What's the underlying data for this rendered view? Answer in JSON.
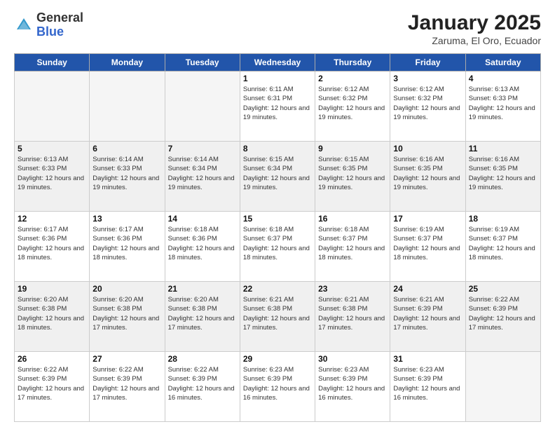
{
  "logo": {
    "general": "General",
    "blue": "Blue"
  },
  "title": "January 2025",
  "subtitle": "Zaruma, El Oro, Ecuador",
  "days_of_week": [
    "Sunday",
    "Monday",
    "Tuesday",
    "Wednesday",
    "Thursday",
    "Friday",
    "Saturday"
  ],
  "weeks": [
    [
      {
        "day": "",
        "info": ""
      },
      {
        "day": "",
        "info": ""
      },
      {
        "day": "",
        "info": ""
      },
      {
        "day": "1",
        "info": "Sunrise: 6:11 AM\nSunset: 6:31 PM\nDaylight: 12 hours and 19 minutes."
      },
      {
        "day": "2",
        "info": "Sunrise: 6:12 AM\nSunset: 6:32 PM\nDaylight: 12 hours and 19 minutes."
      },
      {
        "day": "3",
        "info": "Sunrise: 6:12 AM\nSunset: 6:32 PM\nDaylight: 12 hours and 19 minutes."
      },
      {
        "day": "4",
        "info": "Sunrise: 6:13 AM\nSunset: 6:33 PM\nDaylight: 12 hours and 19 minutes."
      }
    ],
    [
      {
        "day": "5",
        "info": "Sunrise: 6:13 AM\nSunset: 6:33 PM\nDaylight: 12 hours and 19 minutes."
      },
      {
        "day": "6",
        "info": "Sunrise: 6:14 AM\nSunset: 6:33 PM\nDaylight: 12 hours and 19 minutes."
      },
      {
        "day": "7",
        "info": "Sunrise: 6:14 AM\nSunset: 6:34 PM\nDaylight: 12 hours and 19 minutes."
      },
      {
        "day": "8",
        "info": "Sunrise: 6:15 AM\nSunset: 6:34 PM\nDaylight: 12 hours and 19 minutes."
      },
      {
        "day": "9",
        "info": "Sunrise: 6:15 AM\nSunset: 6:35 PM\nDaylight: 12 hours and 19 minutes."
      },
      {
        "day": "10",
        "info": "Sunrise: 6:16 AM\nSunset: 6:35 PM\nDaylight: 12 hours and 19 minutes."
      },
      {
        "day": "11",
        "info": "Sunrise: 6:16 AM\nSunset: 6:35 PM\nDaylight: 12 hours and 19 minutes."
      }
    ],
    [
      {
        "day": "12",
        "info": "Sunrise: 6:17 AM\nSunset: 6:36 PM\nDaylight: 12 hours and 18 minutes."
      },
      {
        "day": "13",
        "info": "Sunrise: 6:17 AM\nSunset: 6:36 PM\nDaylight: 12 hours and 18 minutes."
      },
      {
        "day": "14",
        "info": "Sunrise: 6:18 AM\nSunset: 6:36 PM\nDaylight: 12 hours and 18 minutes."
      },
      {
        "day": "15",
        "info": "Sunrise: 6:18 AM\nSunset: 6:37 PM\nDaylight: 12 hours and 18 minutes."
      },
      {
        "day": "16",
        "info": "Sunrise: 6:18 AM\nSunset: 6:37 PM\nDaylight: 12 hours and 18 minutes."
      },
      {
        "day": "17",
        "info": "Sunrise: 6:19 AM\nSunset: 6:37 PM\nDaylight: 12 hours and 18 minutes."
      },
      {
        "day": "18",
        "info": "Sunrise: 6:19 AM\nSunset: 6:37 PM\nDaylight: 12 hours and 18 minutes."
      }
    ],
    [
      {
        "day": "19",
        "info": "Sunrise: 6:20 AM\nSunset: 6:38 PM\nDaylight: 12 hours and 18 minutes."
      },
      {
        "day": "20",
        "info": "Sunrise: 6:20 AM\nSunset: 6:38 PM\nDaylight: 12 hours and 17 minutes."
      },
      {
        "day": "21",
        "info": "Sunrise: 6:20 AM\nSunset: 6:38 PM\nDaylight: 12 hours and 17 minutes."
      },
      {
        "day": "22",
        "info": "Sunrise: 6:21 AM\nSunset: 6:38 PM\nDaylight: 12 hours and 17 minutes."
      },
      {
        "day": "23",
        "info": "Sunrise: 6:21 AM\nSunset: 6:38 PM\nDaylight: 12 hours and 17 minutes."
      },
      {
        "day": "24",
        "info": "Sunrise: 6:21 AM\nSunset: 6:39 PM\nDaylight: 12 hours and 17 minutes."
      },
      {
        "day": "25",
        "info": "Sunrise: 6:22 AM\nSunset: 6:39 PM\nDaylight: 12 hours and 17 minutes."
      }
    ],
    [
      {
        "day": "26",
        "info": "Sunrise: 6:22 AM\nSunset: 6:39 PM\nDaylight: 12 hours and 17 minutes."
      },
      {
        "day": "27",
        "info": "Sunrise: 6:22 AM\nSunset: 6:39 PM\nDaylight: 12 hours and 17 minutes."
      },
      {
        "day": "28",
        "info": "Sunrise: 6:22 AM\nSunset: 6:39 PM\nDaylight: 12 hours and 16 minutes."
      },
      {
        "day": "29",
        "info": "Sunrise: 6:23 AM\nSunset: 6:39 PM\nDaylight: 12 hours and 16 minutes."
      },
      {
        "day": "30",
        "info": "Sunrise: 6:23 AM\nSunset: 6:39 PM\nDaylight: 12 hours and 16 minutes."
      },
      {
        "day": "31",
        "info": "Sunrise: 6:23 AM\nSunset: 6:39 PM\nDaylight: 12 hours and 16 minutes."
      },
      {
        "day": "",
        "info": ""
      }
    ]
  ]
}
